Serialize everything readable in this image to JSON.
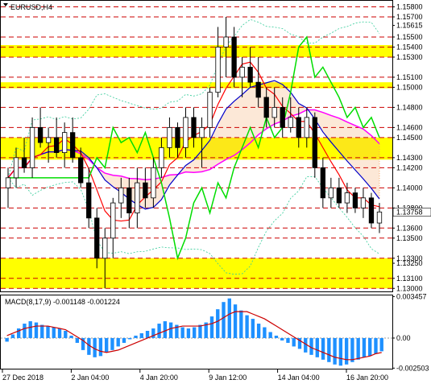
{
  "window": {
    "title": "EURUSD,H4"
  },
  "colors": {
    "background": "#ffffff",
    "grid_level": "#cc0000",
    "yellow_zone": "#ffff00",
    "candle": "#000000",
    "ma_red": "#ff0000",
    "ma_blue": "#0000cc",
    "magenta": "#ff00ff",
    "green": "#00dd00",
    "bands": "#33cc99",
    "cloud": "#f4a460",
    "macd_bar": "#1e90ff",
    "macd_signal": "#cc0000"
  },
  "chart_data": [
    {
      "type": "candlestick",
      "symbol": "EURUSD",
      "timeframe": "H4",
      "title": "EURUSD,H4",
      "ylim": [
        1.1297,
        1.1586
      ],
      "current_price": "1.13758",
      "high_label": "1.15615",
      "low_label": "1.13250",
      "price_ticks": [
        "1.15800",
        "1.15700",
        "1.15615",
        "1.15500",
        "1.15400",
        "1.15300",
        "1.15100",
        "1.15000",
        "1.14800",
        "1.14600",
        "1.14500",
        "1.14300",
        "1.14200",
        "1.14000",
        "1.13800",
        "1.13758",
        "1.13600",
        "1.13500",
        "1.13300",
        "1.13250",
        "1.13100",
        "1.13000"
      ],
      "level_lines": [
        1.158,
        1.157,
        1.155,
        1.154,
        1.153,
        1.151,
        1.15,
        1.148,
        1.146,
        1.145,
        1.143,
        1.142,
        1.14,
        1.138,
        1.136,
        1.135,
        1.133,
        1.131,
        1.13
      ],
      "yellow_zones": [
        [
          1.153,
          1.1542
        ],
        [
          1.1499,
          1.1505
        ],
        [
          1.1428,
          1.145
        ],
        [
          1.13,
          1.133
        ]
      ],
      "x_labels": [
        "27 Dec 2018",
        "2 Jan 04:00",
        "4 Jan 20:00",
        "9 Jan 12:00",
        "14 Jan 04:00",
        "16 Jan 20:00"
      ],
      "candles": [
        {
          "o": 1.14,
          "h": 1.142,
          "l": 1.138,
          "c": 1.141
        },
        {
          "o": 1.141,
          "h": 1.144,
          "l": 1.14,
          "c": 1.143
        },
        {
          "o": 1.143,
          "h": 1.145,
          "l": 1.1415,
          "c": 1.142
        },
        {
          "o": 1.142,
          "h": 1.147,
          "l": 1.141,
          "c": 1.146
        },
        {
          "o": 1.146,
          "h": 1.148,
          "l": 1.144,
          "c": 1.1445
        },
        {
          "o": 1.1445,
          "h": 1.146,
          "l": 1.1425,
          "c": 1.145
        },
        {
          "o": 1.145,
          "h": 1.147,
          "l": 1.143,
          "c": 1.1435
        },
        {
          "o": 1.1435,
          "h": 1.1465,
          "l": 1.142,
          "c": 1.1455
        },
        {
          "o": 1.1455,
          "h": 1.147,
          "l": 1.1425,
          "c": 1.143
        },
        {
          "o": 1.143,
          "h": 1.144,
          "l": 1.14,
          "c": 1.1405
        },
        {
          "o": 1.1405,
          "h": 1.142,
          "l": 1.136,
          "c": 1.137
        },
        {
          "o": 1.137,
          "h": 1.138,
          "l": 1.132,
          "c": 1.133
        },
        {
          "o": 1.133,
          "h": 1.136,
          "l": 1.13,
          "c": 1.135
        },
        {
          "o": 1.135,
          "h": 1.139,
          "l": 1.133,
          "c": 1.1385
        },
        {
          "o": 1.1385,
          "h": 1.141,
          "l": 1.137,
          "c": 1.14
        },
        {
          "o": 1.14,
          "h": 1.141,
          "l": 1.136,
          "c": 1.1375
        },
        {
          "o": 1.1375,
          "h": 1.142,
          "l": 1.136,
          "c": 1.1405
        },
        {
          "o": 1.1405,
          "h": 1.142,
          "l": 1.138,
          "c": 1.139
        },
        {
          "o": 1.139,
          "h": 1.143,
          "l": 1.138,
          "c": 1.142
        },
        {
          "o": 1.142,
          "h": 1.145,
          "l": 1.141,
          "c": 1.144
        },
        {
          "o": 1.144,
          "h": 1.147,
          "l": 1.143,
          "c": 1.146
        },
        {
          "o": 1.146,
          "h": 1.1465,
          "l": 1.143,
          "c": 1.144
        },
        {
          "o": 1.144,
          "h": 1.148,
          "l": 1.143,
          "c": 1.147
        },
        {
          "o": 1.147,
          "h": 1.148,
          "l": 1.144,
          "c": 1.145
        },
        {
          "o": 1.145,
          "h": 1.147,
          "l": 1.142,
          "c": 1.146
        },
        {
          "o": 1.146,
          "h": 1.15,
          "l": 1.145,
          "c": 1.1495
        },
        {
          "o": 1.1495,
          "h": 1.156,
          "l": 1.149,
          "c": 1.154
        },
        {
          "o": 1.154,
          "h": 1.157,
          "l": 1.151,
          "c": 1.155
        },
        {
          "o": 1.155,
          "h": 1.156,
          "l": 1.15,
          "c": 1.151
        },
        {
          "o": 1.151,
          "h": 1.153,
          "l": 1.149,
          "c": 1.152
        },
        {
          "o": 1.152,
          "h": 1.154,
          "l": 1.15,
          "c": 1.1505
        },
        {
          "o": 1.1505,
          "h": 1.153,
          "l": 1.148,
          "c": 1.149
        },
        {
          "o": 1.149,
          "h": 1.15,
          "l": 1.146,
          "c": 1.147
        },
        {
          "o": 1.147,
          "h": 1.15,
          "l": 1.146,
          "c": 1.148
        },
        {
          "o": 1.148,
          "h": 1.149,
          "l": 1.145,
          "c": 1.146
        },
        {
          "o": 1.146,
          "h": 1.149,
          "l": 1.1455,
          "c": 1.147
        },
        {
          "o": 1.147,
          "h": 1.148,
          "l": 1.144,
          "c": 1.145
        },
        {
          "o": 1.145,
          "h": 1.148,
          "l": 1.144,
          "c": 1.147
        },
        {
          "o": 1.147,
          "h": 1.1475,
          "l": 1.141,
          "c": 1.142
        },
        {
          "o": 1.142,
          "h": 1.143,
          "l": 1.138,
          "c": 1.139
        },
        {
          "o": 1.139,
          "h": 1.141,
          "l": 1.138,
          "c": 1.14
        },
        {
          "o": 1.14,
          "h": 1.141,
          "l": 1.138,
          "c": 1.1385
        },
        {
          "o": 1.1385,
          "h": 1.1405,
          "l": 1.1375,
          "c": 1.1395
        },
        {
          "o": 1.1395,
          "h": 1.14,
          "l": 1.1375,
          "c": 1.138
        },
        {
          "o": 1.138,
          "h": 1.14,
          "l": 1.137,
          "c": 1.139
        },
        {
          "o": 1.139,
          "h": 1.1395,
          "l": 1.136,
          "c": 1.1365
        },
        {
          "o": 1.1365,
          "h": 1.1385,
          "l": 1.1355,
          "c": 1.1376
        }
      ]
    },
    {
      "type": "bar",
      "title": "MACD(8,17,9)",
      "values_label": "-0.001148 -0.001224",
      "ylim": [
        -0.00255,
        0.00355
      ],
      "y_ticks": [
        "0.003457",
        "0.00",
        "-0.002503"
      ],
      "histogram": [
        -0.0003,
        0.0003,
        0.0008,
        0.0012,
        0.0014,
        0.0013,
        0.0011,
        0.001,
        0.0009,
        0.0008,
        0.0006,
        0.0002,
        -0.0004,
        -0.001,
        -0.0014,
        -0.0016,
        -0.0015,
        -0.0012,
        -0.001,
        -0.0007,
        -0.0004,
        -0.0001,
        0.0002,
        0.0004,
        0.0006,
        0.0008,
        0.0012,
        0.0014,
        0.0013,
        0.0011,
        0.0009,
        0.0008,
        0.0009,
        0.0011,
        0.0013,
        0.0018,
        0.0024,
        0.003,
        0.0033,
        0.0028,
        0.0023,
        0.0019,
        0.0016,
        0.0012,
        0.0009,
        0.0005,
        0.0002,
        -0.0002,
        -0.0004,
        -0.0007,
        -0.0009,
        -0.0012,
        -0.0014,
        -0.0016,
        -0.0018,
        -0.002,
        -0.0022,
        -0.0023,
        -0.0022,
        -0.002,
        -0.0018,
        -0.0016,
        -0.0015,
        -0.0013,
        -0.0011
      ],
      "signal": [
        0.0002,
        0.0004,
        0.0006,
        0.0008,
        0.0009,
        0.001,
        0.001,
        0.001,
        0.0009,
        0.0008,
        0.0007,
        0.0004,
        0.0001,
        -0.0002,
        -0.0006,
        -0.0009,
        -0.0011,
        -0.0012,
        -0.0011,
        -0.001,
        -0.0008,
        -0.0006,
        -0.0004,
        -0.0002,
        0.0,
        0.0002,
        0.0004,
        0.0006,
        0.0008,
        0.0009,
        0.001,
        0.001,
        0.001,
        0.001,
        0.0011,
        0.0012,
        0.0014,
        0.0017,
        0.002,
        0.0022,
        0.0022,
        0.0022,
        0.002,
        0.0018,
        0.0016,
        0.0013,
        0.001,
        0.0007,
        0.0004,
        0.0001,
        -0.0002,
        -0.0005,
        -0.0008,
        -0.001,
        -0.0012,
        -0.0014,
        -0.0016,
        -0.0017,
        -0.0018,
        -0.0018,
        -0.0017,
        -0.0016,
        -0.0015,
        -0.0013,
        -0.0012
      ]
    }
  ]
}
